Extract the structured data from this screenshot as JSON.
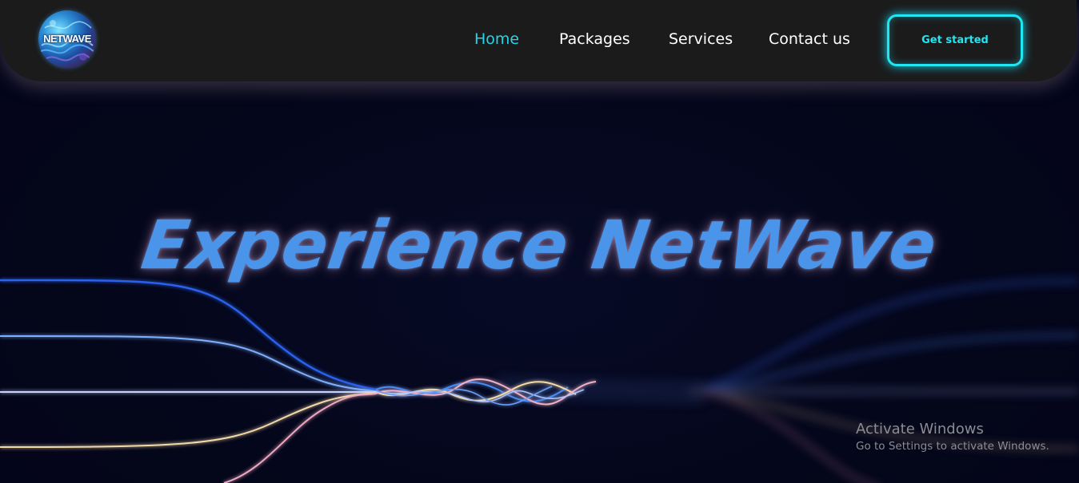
{
  "brand": {
    "logo_text": "NETWAVE",
    "accent_color": "#21e6f2",
    "active_link_color": "#27d3e6",
    "hero_color": "#4a95ea"
  },
  "nav": {
    "links": [
      {
        "label": "Home",
        "active": true
      },
      {
        "label": "Packages",
        "active": false
      },
      {
        "label": "Services",
        "active": false
      },
      {
        "label": "Contact us",
        "active": false
      }
    ],
    "cta_label": "Get started"
  },
  "hero": {
    "title": "Experience NetWave"
  },
  "watermark": {
    "title": "Activate Windows",
    "subtitle": "Go to Settings to activate Windows."
  }
}
